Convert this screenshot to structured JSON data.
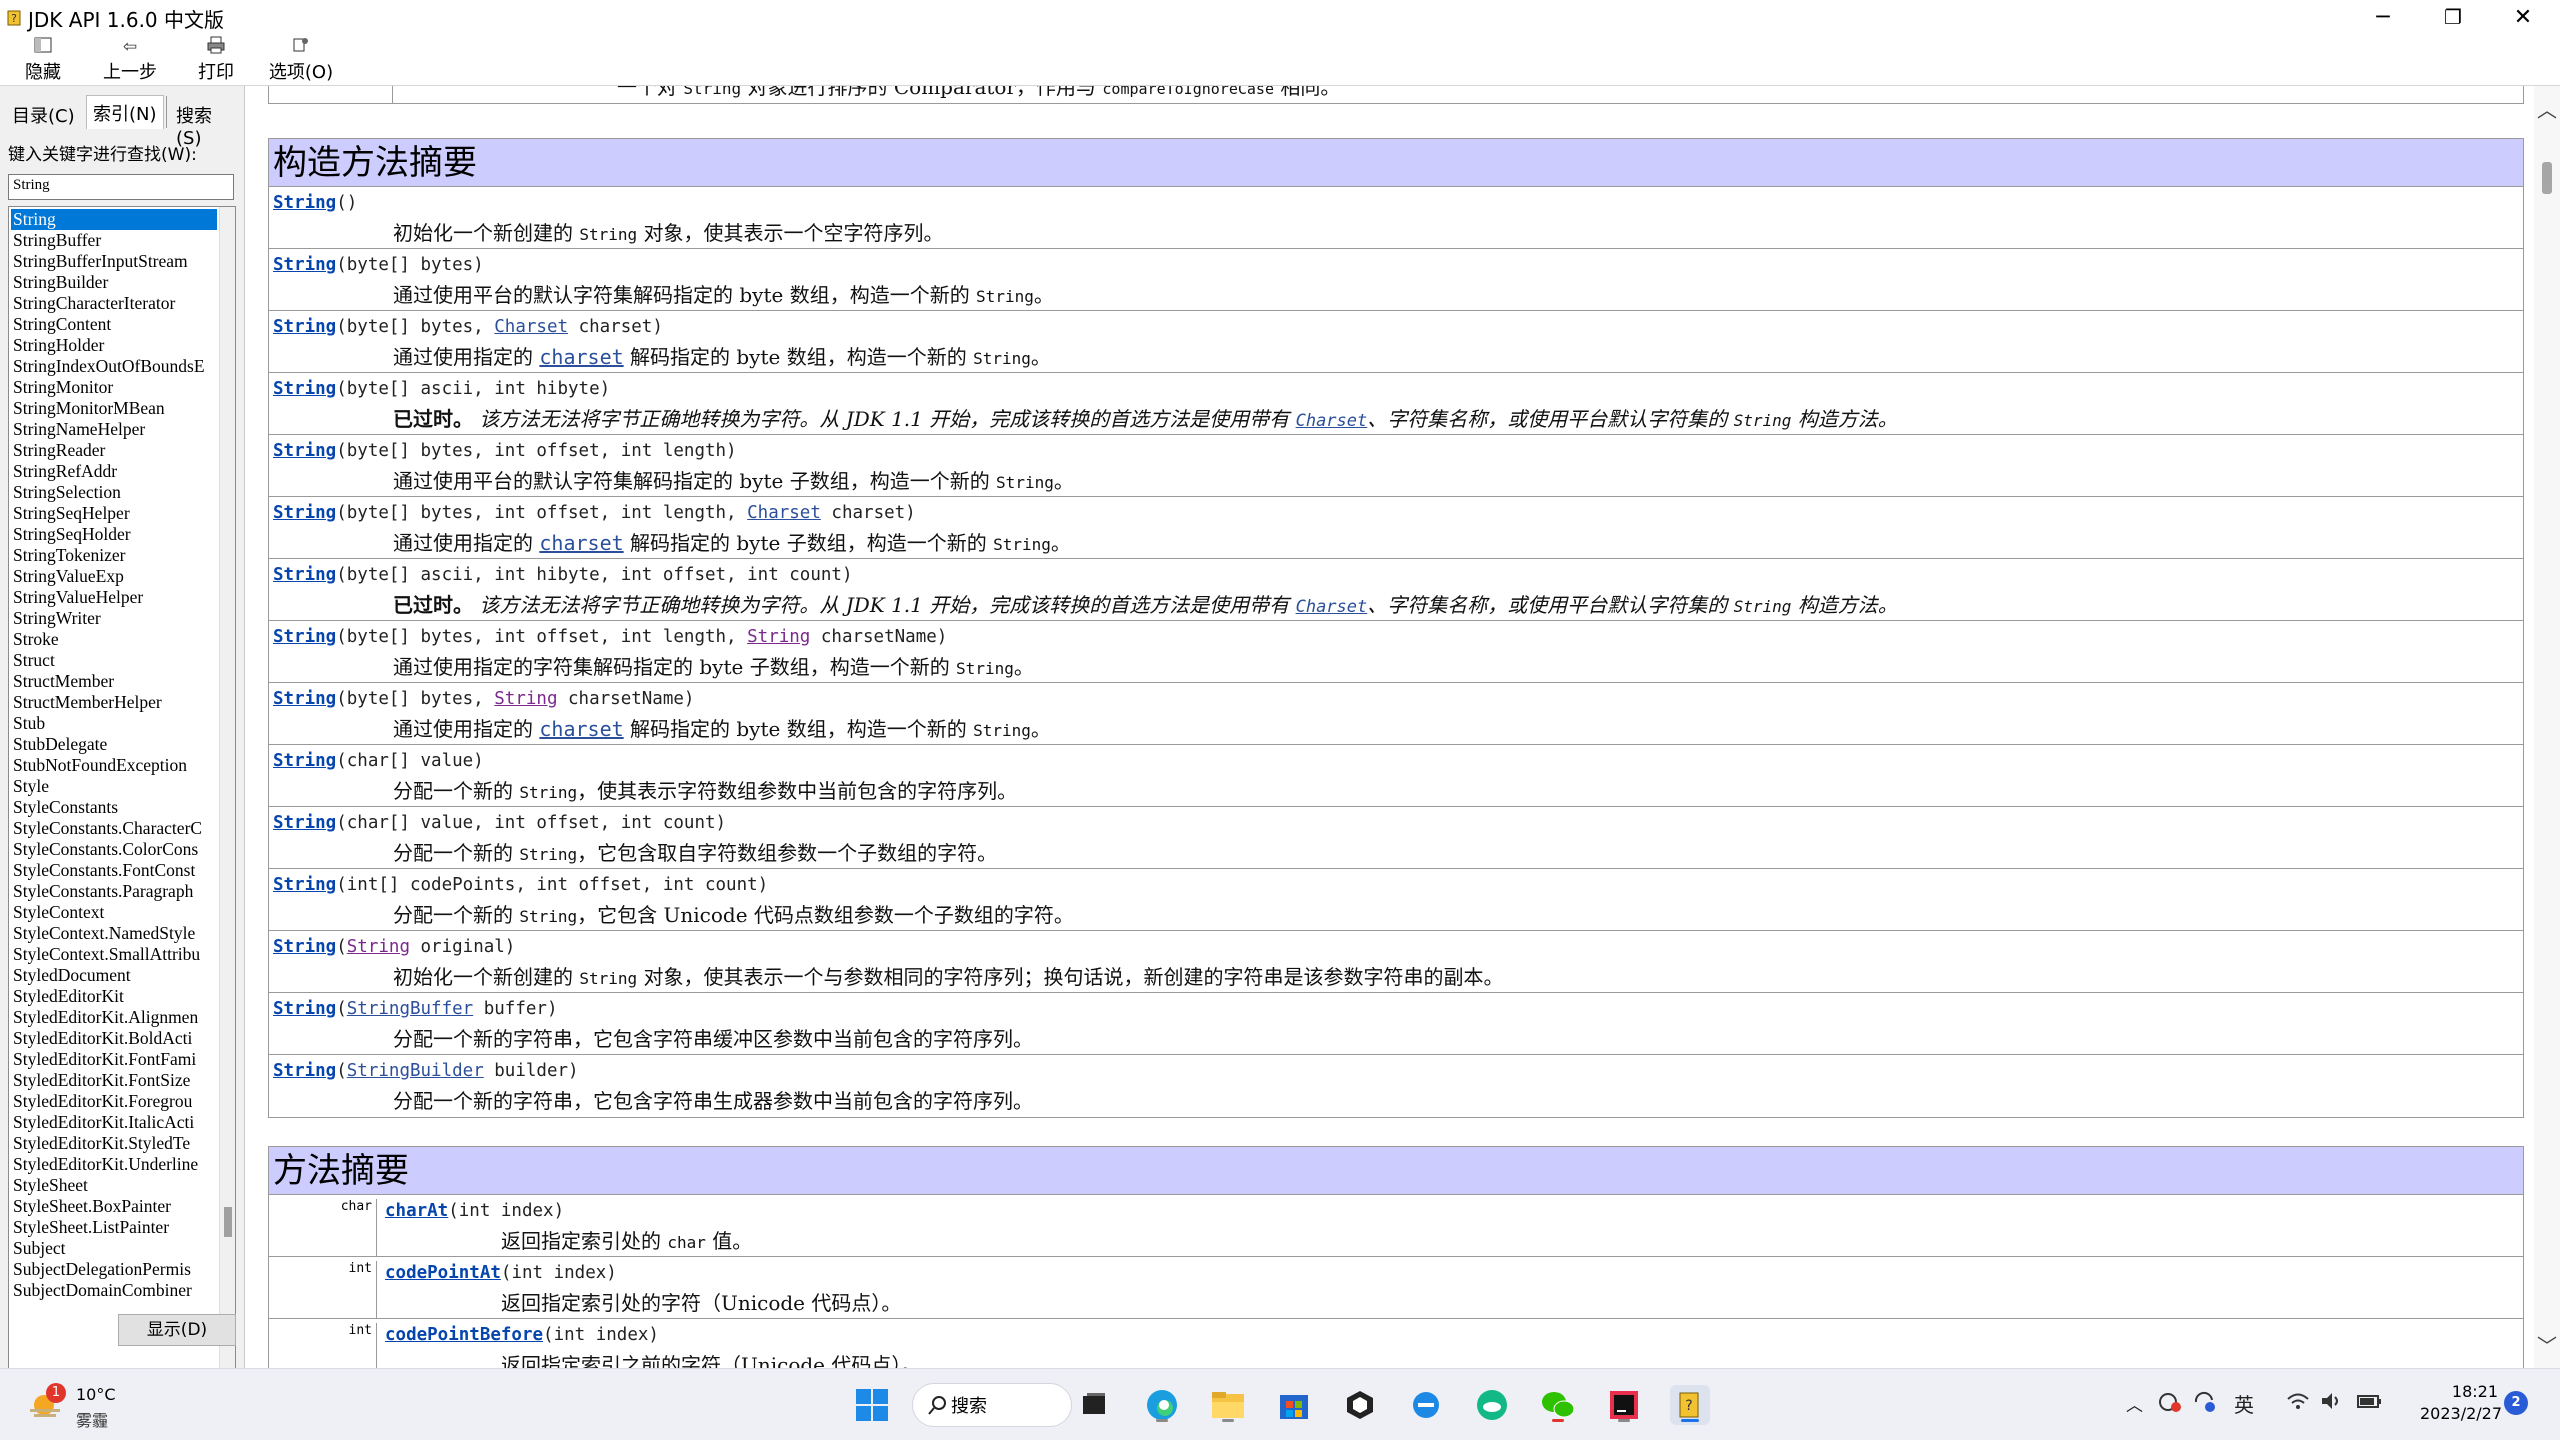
{
  "window": {
    "title": "JDK API 1.6.0 中文版",
    "controls": {
      "minimize": "─",
      "restore": "❐",
      "close": "✕"
    }
  },
  "toolbar": {
    "hide": "隐藏",
    "back": "上一步",
    "print": "打印",
    "options": "选项(O)"
  },
  "nav": {
    "tabs": [
      "目录(C)",
      "索引(N)",
      "搜索(S)"
    ],
    "active_tab": "索引(N)",
    "search_label": "键入关键字进行查找(W):",
    "search_value": "String",
    "show_button": "显示(D)",
    "items": [
      "String",
      "StringBuffer",
      "StringBufferInputStream",
      "StringBuilder",
      "StringCharacterIterator",
      "StringContent",
      "StringHolder",
      "StringIndexOutOfBoundsE",
      "StringMonitor",
      "StringMonitorMBean",
      "StringNameHelper",
      "StringReader",
      "StringRefAddr",
      "StringSelection",
      "StringSeqHelper",
      "StringSeqHolder",
      "StringTokenizer",
      "StringValueExp",
      "StringValueHelper",
      "StringWriter",
      "Stroke",
      "Struct",
      "StructMember",
      "StructMemberHelper",
      "Stub",
      "StubDelegate",
      "StubNotFoundException",
      "Style",
      "StyleConstants",
      "StyleConstants.CharacterC",
      "StyleConstants.ColorCons",
      "StyleConstants.FontConst",
      "StyleConstants.Paragraph",
      "StyleContext",
      "StyleContext.NamedStyle",
      "StyleContext.SmallAttribu",
      "StyledDocument",
      "StyledEditorKit",
      "StyledEditorKit.Alignmen",
      "StyledEditorKit.BoldActi",
      "StyledEditorKit.FontFami",
      "StyledEditorKit.FontSize",
      "StyledEditorKit.Foregrou",
      "StyledEditorKit.ItalicActi",
      "StyledEditorKit.StyledTe",
      "StyledEditorKit.Underline",
      "StyleSheet",
      "StyleSheet.BoxPainter",
      "StyleSheet.ListPainter",
      "Subject",
      "SubjectDelegationPermis",
      "SubjectDomainCombiner"
    ],
    "selected_index": 0
  },
  "content": {
    "top_partial": {
      "prefix": "一个对 ",
      "code1": "String",
      "mid": " 对象进行排序的 Comparator，作用与 ",
      "code2": "compareToIgnoreCase",
      "suffix": " 相同。"
    },
    "constructor_header": "构造方法摘要",
    "method_header": "方法摘要",
    "deprecated_label": "已过时。",
    "deprecated_text_a": "该方法无法将字节正确地转换为字符。从 JDK 1.1 开始，完成该转换的首选方法是使用带有 ",
    "deprecated_link": "Charset",
    "deprecated_text_b": "、字符集名称，或使用平台默认字符集的 ",
    "deprecated_code": "String",
    "deprecated_text_c": " 构造方法。",
    "constructors": [
      {
        "name": "String",
        "params": "()",
        "desc_a": "初始化一个新创建的 ",
        "desc_code": "String",
        "desc_b": " 对象，使其表示一个空字符序列。"
      },
      {
        "name": "String",
        "params": "(byte[] bytes)",
        "desc_a": "通过使用平台的默认字符集解码指定的 byte 数组，构造一个新的 ",
        "desc_code": "String",
        "desc_b": "。"
      },
      {
        "name": "String",
        "p1": "(byte[] bytes, ",
        "plink": "Charset",
        "p2": " charset)",
        "desc_a": "通过使用指定的 ",
        "desc_link": "charset",
        "desc_b": " 解码指定的 byte 数组，构造一个新的 ",
        "desc_code": "String",
        "desc_c": "。"
      },
      {
        "name": "String",
        "params": "(byte[] ascii, int hibyte)",
        "deprecated": true
      },
      {
        "name": "String",
        "params": "(byte[] bytes, int offset, int length)",
        "desc_a": "通过使用平台的默认字符集解码指定的 byte 子数组，构造一个新的 ",
        "desc_code": "String",
        "desc_b": "。"
      },
      {
        "name": "String",
        "p1": "(byte[] bytes, int offset, int length, ",
        "plink": "Charset",
        "p2": " charset)",
        "desc_a": "通过使用指定的 ",
        "desc_link": "charset",
        "desc_b": " 解码指定的 byte 子数组，构造一个新的 ",
        "desc_code": "String",
        "desc_c": "。"
      },
      {
        "name": "String",
        "params": "(byte[] ascii, int hibyte, int offset, int count)",
        "deprecated": true
      },
      {
        "name": "String",
        "p1": "(byte[] bytes, int offset, int length, ",
        "plink": "String",
        "p2": " charsetName)",
        "desc_a": "通过使用指定的字符集解码指定的 byte 子数组，构造一个新的 ",
        "desc_code": "String",
        "desc_b": "。"
      },
      {
        "name": "String",
        "p1": "(byte[] bytes, ",
        "plink": "String",
        "p2": " charsetName)",
        "desc_a": "通过使用指定的 ",
        "desc_link": "charset",
        "desc_b": " 解码指定的 byte 数组，构造一个新的 ",
        "desc_code": "String",
        "desc_c": "。"
      },
      {
        "name": "String",
        "params": "(char[] value)",
        "desc_a": "分配一个新的 ",
        "desc_code": "String",
        "desc_b": "，使其表示字符数组参数中当前包含的字符序列。"
      },
      {
        "name": "String",
        "params": "(char[] value, int offset, int count)",
        "desc_a": "分配一个新的 ",
        "desc_code": "String",
        "desc_b": "，它包含取自字符数组参数一个子数组的字符。"
      },
      {
        "name": "String",
        "params": "(int[] codePoints, int offset, int count)",
        "desc_a": "分配一个新的 ",
        "desc_code": "String",
        "desc_b": "，它包含 Unicode 代码点数组参数一个子数组的字符。"
      },
      {
        "name": "String",
        "p1": "(",
        "plink": "String",
        "p2": " original)",
        "desc_a": "初始化一个新创建的 ",
        "desc_code": "String",
        "desc_b": " 对象，使其表示一个与参数相同的字符序列；换句话说，新创建的字符串是该参数字符串的副本。"
      },
      {
        "name": "String",
        "p1": "(",
        "plink": "StringBuffer",
        "p2": " buffer)",
        "desc_a": "分配一个新的字符串，它包含字符串缓冲区参数中当前包含的字符序列。"
      },
      {
        "name": "String",
        "p1": "(",
        "plink": "StringBuilder",
        "p2": " builder)",
        "desc_a": "分配一个新的字符串，它包含字符串生成器参数中当前包含的字符序列。"
      }
    ],
    "methods": [
      {
        "rtype": "char",
        "name": "charAt",
        "params": "(int index)",
        "desc_a": "返回指定索引处的 ",
        "desc_code": "char",
        "desc_b": " 值。"
      },
      {
        "rtype": "int",
        "name": "codePointAt",
        "params": "(int index)",
        "desc_a": "返回指定索引处的字符（Unicode 代码点）。"
      },
      {
        "rtype": "int",
        "name": "codePointBefore",
        "params": "(int index)",
        "desc_a": "返回指定索引之前的字符（Unicode 代码点）。"
      }
    ]
  },
  "taskbar": {
    "weather": {
      "temp": "10°C",
      "condition": "雾霾",
      "badge": "1"
    },
    "search_label": "搜索",
    "apps": [
      "start-icon",
      "search-icon",
      "task-view-icon",
      "edge-icon",
      "file-explorer-icon",
      "store-icon",
      "unity-icon",
      "ie-icon",
      "onedrive-icon",
      "wechat-icon",
      "intellij-icon",
      "chm-viewer-icon"
    ],
    "ime": "英",
    "time": "18:21",
    "date": "2023/2/27",
    "notifications": "2"
  }
}
